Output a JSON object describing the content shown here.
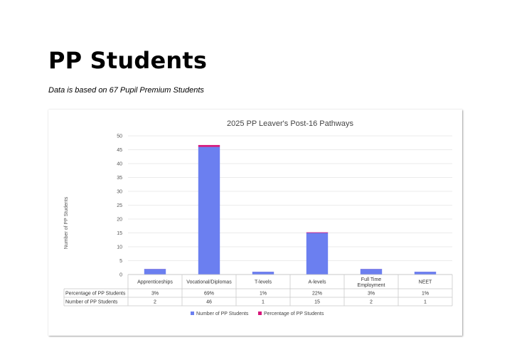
{
  "page": {
    "title": "PP Students",
    "subtitle": "Data is based on 67 Pupil Premium Students"
  },
  "chart_data": {
    "type": "bar",
    "stacked": true,
    "title": "2025 PP Leaver's Post-16 Pathways",
    "ylabel": "Number of PP Students",
    "xlabel": "",
    "ylim": [
      0,
      50
    ],
    "yticks": [
      0,
      5,
      10,
      15,
      20,
      25,
      30,
      35,
      40,
      45,
      50
    ],
    "grid": true,
    "legend_position": "bottom",
    "categories": [
      "Apprenticeships",
      "Vocational/Diplomas",
      "T-levels",
      "A-levels",
      "Full Time Employment",
      "NEET"
    ],
    "series": [
      {
        "name": "Number of PP Students",
        "color": "#6b7ff0",
        "values": [
          2,
          46,
          1,
          15,
          2,
          1
        ],
        "labels": [
          "2",
          "46",
          "1",
          "15",
          "2",
          "1"
        ]
      },
      {
        "name": "Percentage of PP Students",
        "color": "#d6157a",
        "values": [
          0.03,
          0.69,
          0.01,
          0.22,
          0.03,
          0.01
        ],
        "labels": [
          "3%",
          "69%",
          "1%",
          "22%",
          "3%",
          "1%"
        ]
      }
    ],
    "table_row_labels": [
      "Percentage of PP Students",
      "Number of PP Students"
    ]
  }
}
